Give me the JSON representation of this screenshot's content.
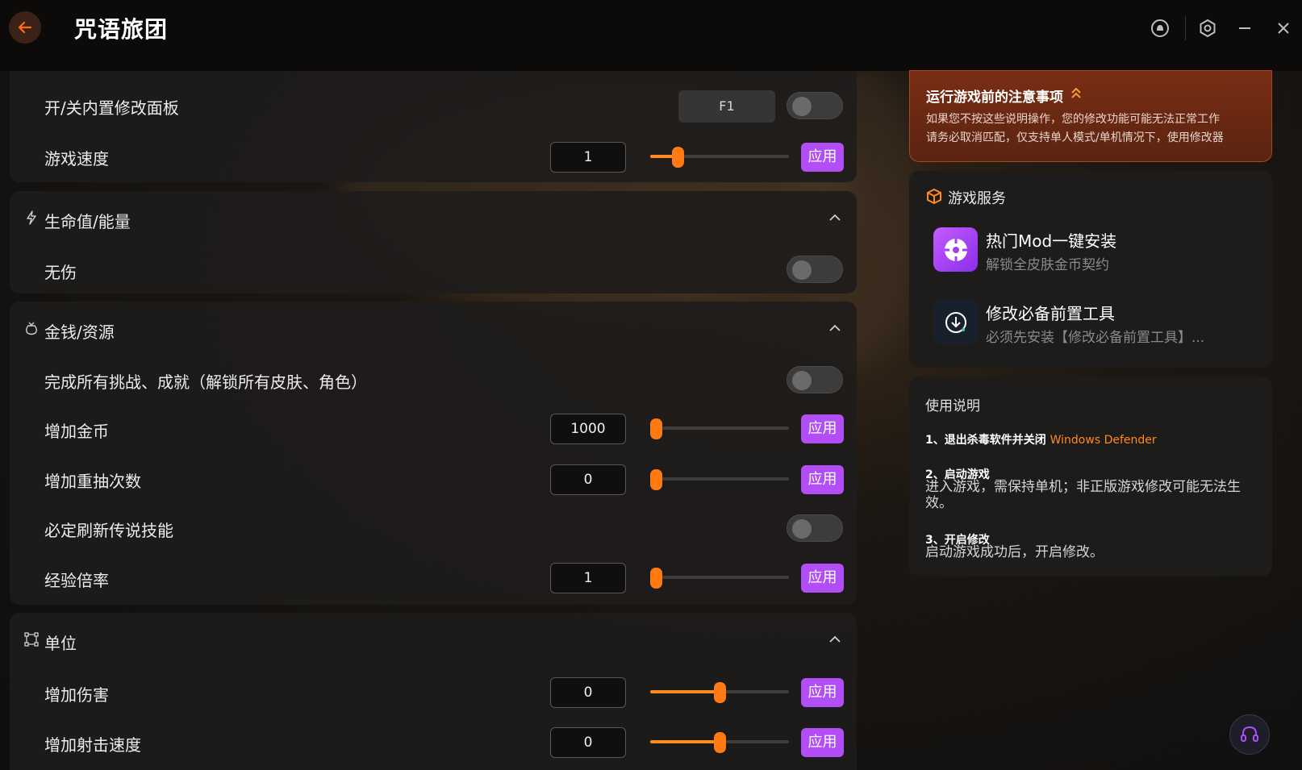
{
  "app": {
    "title": "咒语旅团"
  },
  "titlebar": {
    "icons": [
      "back-arrow-icon",
      "bell-icon",
      "settings-icon",
      "minimize-icon",
      "close-icon"
    ]
  },
  "panel_top": {
    "rows": [
      {
        "label": "开/关内置修改面板",
        "hotkey": "F1"
      },
      {
        "label": "游戏速度",
        "value": "1",
        "apply": "应用",
        "slider_fraction": 0.2
      }
    ]
  },
  "section_health": {
    "title": "生命值/能量",
    "icon": "lightning-icon",
    "rows": [
      {
        "label": "无伤"
      }
    ]
  },
  "section_money": {
    "title": "金钱/资源",
    "icon": "money-bag-icon",
    "rows": [
      {
        "label": "完成所有挑战、成就（解锁所有皮肤、角色）"
      },
      {
        "label": "增加金币",
        "value": "1000",
        "apply": "应用",
        "slider_fraction": 0.0
      },
      {
        "label": "增加重抽次数",
        "value": "0",
        "apply": "应用",
        "slider_fraction": 0.0
      },
      {
        "label": "必定刷新传说技能"
      },
      {
        "label": "经验倍率",
        "value": "1",
        "apply": "应用",
        "slider_fraction": 0.0
      }
    ]
  },
  "section_unit": {
    "title": "单位",
    "icon": "nodes-icon",
    "rows": [
      {
        "label": "增加伤害",
        "value": "0",
        "apply": "应用",
        "slider_fraction": 0.5
      },
      {
        "label": "增加射击速度",
        "value": "0",
        "apply": "应用",
        "slider_fraction": 0.5
      }
    ]
  },
  "notice": {
    "title": "运行游戏前的注意事项",
    "line1": "如果您不按这些说明操作，您的修改功能可能无法正常工作",
    "line2": "请务必取消匹配，仅支持单人模式/单机情况下，使用修改器"
  },
  "services": {
    "title": "游戏服务",
    "items": [
      {
        "name": "热门Mod一键安装",
        "desc": "解锁全皮肤金币契约",
        "icon": "mod-install-icon"
      },
      {
        "name": "修改必备前置工具",
        "desc": "必须先安装【修改必备前置工具】...",
        "icon": "download-icon"
      }
    ]
  },
  "guide": {
    "title": "使用说明",
    "step1_head": "1、退出杀毒软件并关闭",
    "step1_highlight": "Windows Defender",
    "step2_head": "2、启动游戏",
    "step2_body": "进入游戏，需保持单机；非正版游戏修改可能无法生效。",
    "step3_head": "3、开启修改",
    "step3_body": "启动游戏成功后，开启修改。"
  },
  "colors": {
    "accent_orange": "#ff7a12",
    "apply_purple": "#b14ef5",
    "notice_red": "#7a2d14"
  }
}
